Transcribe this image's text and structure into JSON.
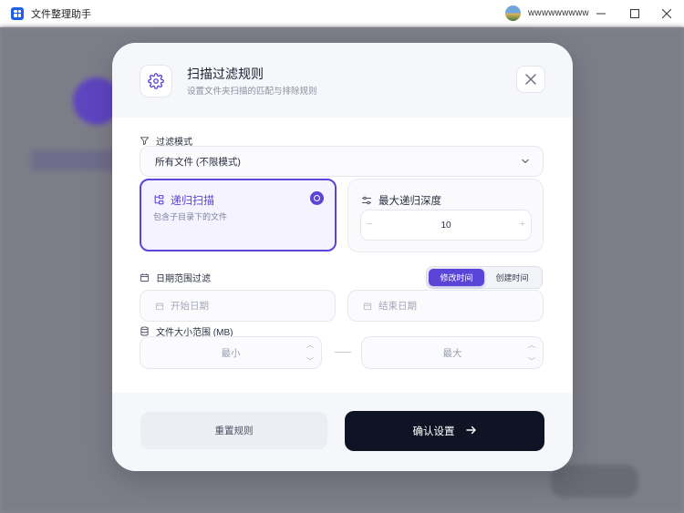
{
  "window": {
    "title": "文件整理助手",
    "username": "wwwwwwwww",
    "minimize": "—",
    "maximize": "☐",
    "close": "✕"
  },
  "modal": {
    "title": "扫描过滤规则",
    "subtitle": "设置文件夹扫描的匹配与排除规则",
    "filter_mode": {
      "label": "过滤模式",
      "selected": "所有文件 (不限模式)"
    },
    "recursive": {
      "title": "递归扫描",
      "desc": "包含子目录下的文件",
      "checked": true
    },
    "depth": {
      "title": "最大递归深度",
      "value": "10",
      "minus": "−",
      "plus": "+"
    },
    "date": {
      "label": "日期范围过滤",
      "toggle": [
        {
          "label": "修改时间",
          "active": true
        },
        {
          "label": "创建时间",
          "active": false
        }
      ],
      "start_placeholder": "开始日期",
      "end_placeholder": "结束日期"
    },
    "size": {
      "label": "文件大小范围 (MB)",
      "min_placeholder": "最小",
      "max_placeholder": "最大"
    },
    "buttons": {
      "reset": "重置规则",
      "confirm": "确认设置"
    }
  },
  "colors": {
    "accent": "#5b45d6",
    "confirm_bg": "#0e1424",
    "logo": "#1e5fe8"
  }
}
